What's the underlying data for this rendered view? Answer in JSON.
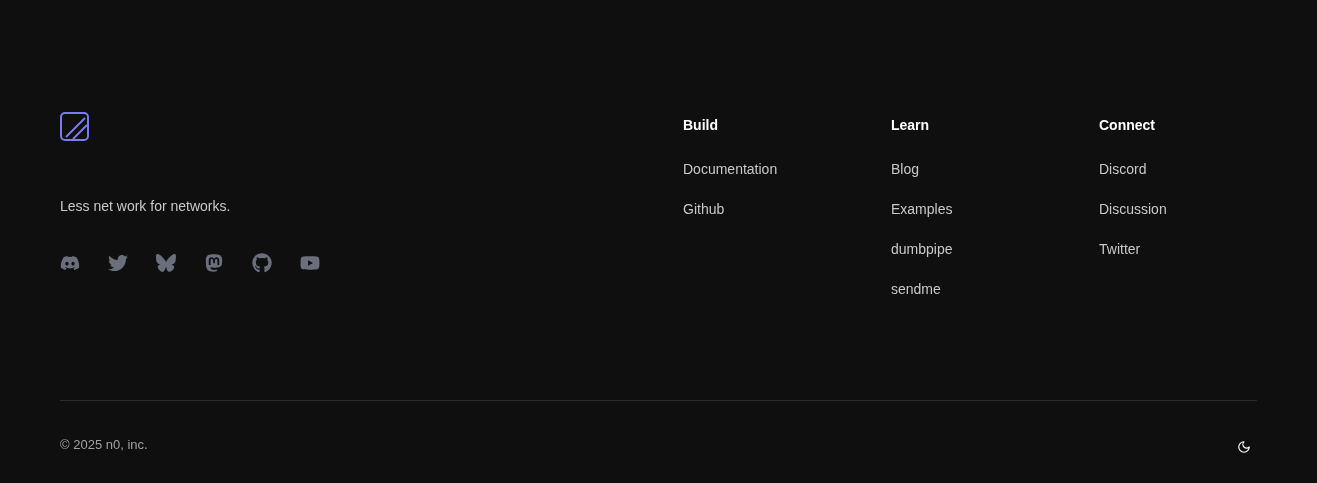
{
  "brand": {
    "tagline": "Less net work for networks."
  },
  "social_links": [
    {
      "kind": "discord"
    },
    {
      "kind": "twitter"
    },
    {
      "kind": "bluesky"
    },
    {
      "kind": "mastodon"
    },
    {
      "kind": "github"
    },
    {
      "kind": "youtube"
    }
  ],
  "columns": [
    {
      "title": "Build",
      "links": [
        "Documentation",
        "Github"
      ]
    },
    {
      "title": "Learn",
      "links": [
        "Blog",
        "Examples",
        "dumbpipe",
        "sendme"
      ]
    },
    {
      "title": "Connect",
      "links": [
        "Discord",
        "Discussion",
        "Twitter"
      ]
    }
  ],
  "copyright": "© 2025 n0, inc."
}
